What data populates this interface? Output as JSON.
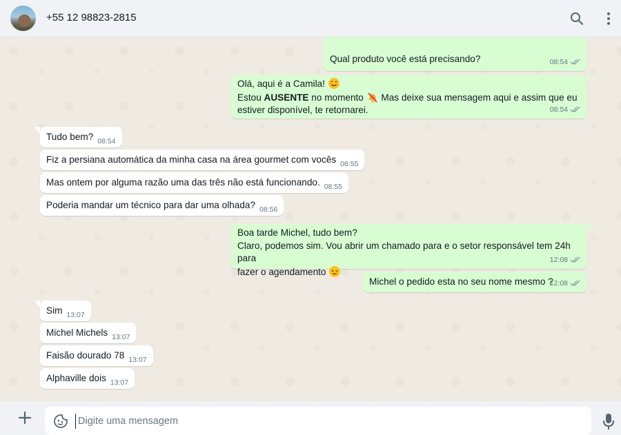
{
  "header": {
    "contact": "+55 12 98823-2815",
    "search_icon": "search-icon",
    "menu_icon": "more-vertical-icon"
  },
  "messages": {
    "m1": {
      "text": "Qual produto você está precisando?",
      "time": "08:54"
    },
    "m2": {
      "line1": "Olá, aqui é a Camila!",
      "line2_prefix": "Estou ",
      "line2_bold": "AUSENTE",
      "line2_suffix": " no momento",
      "line2_rest": " Mas deixe sua mensagem aqui e assim que eu",
      "line3": "estiver disponível, te retornarei.",
      "time": "08:54"
    },
    "m3": {
      "text": "Tudo bem?",
      "time": "08:54"
    },
    "m4": {
      "text": "Fiz a persiana automática da minha casa na área gourmet com vocês",
      "time": "08:55"
    },
    "m5": {
      "text": "Mas ontem por alguma razão uma das três não está funcionando.",
      "time": "08:55"
    },
    "m6": {
      "text": "Poderia mandar um técnico para dar uma olhada?",
      "time": "08:56"
    },
    "m7": {
      "line1": "Boa tarde Michel, tudo bem?",
      "line2": "Claro, podemos sim. Vou abrir um chamado para e o setor responsável tem 24h para",
      "line3": "fazer o agendamento",
      "time": "12:08"
    },
    "m8": {
      "text": "Michel o pedido esta no seu nome mesmo ?",
      "time": "12:08"
    },
    "m9": {
      "text": "Sim",
      "time": "13:07"
    },
    "m10": {
      "text": "Michel Michels",
      "time": "13:07"
    },
    "m11": {
      "text": "Faisão dourado 78",
      "time": "13:07"
    },
    "m12": {
      "text": "Alphaville dois",
      "time": "13:07"
    }
  },
  "composer": {
    "placeholder": "Digite uma mensagem"
  },
  "colors": {
    "incoming": "#ffffff",
    "outgoing": "#d9fdd3",
    "chat_bg": "#efeae2",
    "read_ticks": "#8696a0"
  }
}
